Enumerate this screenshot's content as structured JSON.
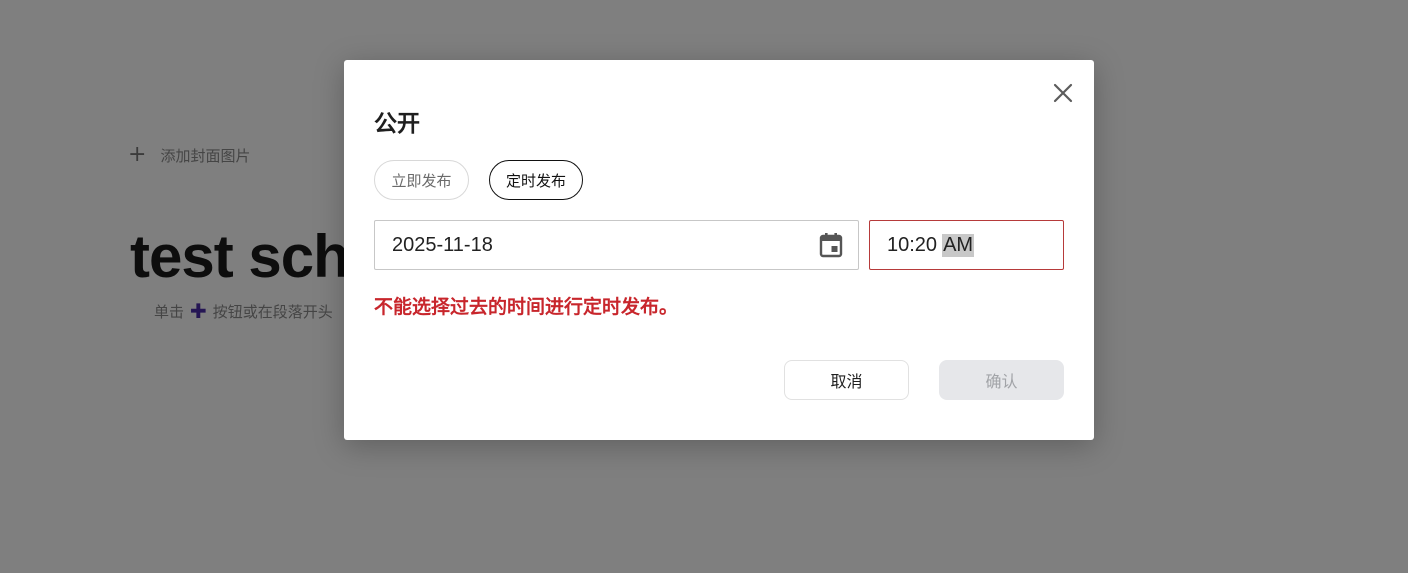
{
  "editor": {
    "add_cover_label": "添加封面图片",
    "doc_title": "test sch",
    "hint_prefix": "单击",
    "hint_suffix": "按钮或在段落开头"
  },
  "modal": {
    "title": "公开",
    "tabs": [
      {
        "label": "立即发布",
        "selected": false
      },
      {
        "label": "定时发布",
        "selected": true
      }
    ],
    "date_value": "2025-11-18",
    "time_value": "10:20",
    "time_ampm": "AM",
    "error_message": "不能选择过去的时间进行定时发布。",
    "cancel_label": "取消",
    "confirm_label": "确认"
  },
  "colors": {
    "error": "#c8262c",
    "accent_purple": "#4b2ca8"
  },
  "icons": {
    "close": "close-icon",
    "calendar": "calendar-icon",
    "add": "plus-icon"
  }
}
